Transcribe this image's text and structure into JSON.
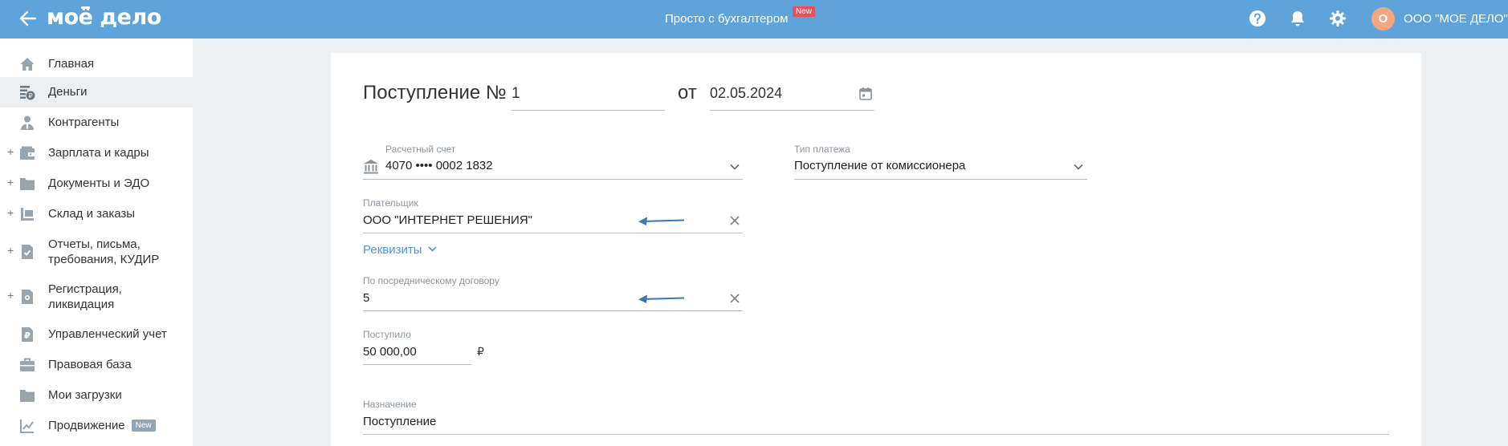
{
  "header": {
    "logo_text": "моё дело",
    "center_link": "Просто с бухгалтером",
    "center_badge": "New",
    "avatar_letter": "О",
    "org_name": "ООО \"МОЕ ДЕЛО\""
  },
  "sidebar": {
    "items": [
      {
        "label": "Главная",
        "icon": "home-icon",
        "expandable": false,
        "active": false
      },
      {
        "label": "Деньги",
        "icon": "money-icon",
        "expandable": false,
        "active": true
      },
      {
        "label": "Контрагенты",
        "icon": "contractor-icon",
        "expandable": false,
        "active": false
      },
      {
        "label": "Зарплата и кадры",
        "icon": "wallet-icon",
        "expandable": true,
        "active": false
      },
      {
        "label": "Документы и ЭДО",
        "icon": "folder-icon",
        "expandable": true,
        "active": false
      },
      {
        "label": "Склад и заказы",
        "icon": "warehouse-icon",
        "expandable": true,
        "active": false
      },
      {
        "label": "Отчеты, письма, требования, КУДИР",
        "icon": "report-icon",
        "expandable": true,
        "active": false
      },
      {
        "label": "Регистрация, ликвидация",
        "icon": "registration-icon",
        "expandable": true,
        "active": false
      },
      {
        "label": "Управленческий учет",
        "icon": "ruble-doc-icon",
        "expandable": false,
        "active": false
      },
      {
        "label": "Правовая база",
        "icon": "briefcase-icon",
        "expandable": false,
        "active": false
      },
      {
        "label": "Мои загрузки",
        "icon": "folder-icon",
        "expandable": false,
        "active": false
      },
      {
        "label": "Продвижение",
        "icon": "growth-chart-icon",
        "expandable": false,
        "active": false,
        "badge": "New"
      }
    ]
  },
  "form": {
    "title": "Поступление №",
    "number": "1",
    "date_prefix": "от",
    "date": "02.05.2024",
    "account_label": "Расчетный счет",
    "account_value": "4070 •••• 0002 1832",
    "payment_type_label": "Тип платежа",
    "payment_type_value": "Поступление от комиссионера",
    "payer_label": "Плательщик",
    "payer_value": "ООО \"ИНТЕРНЕТ РЕШЕНИЯ\"",
    "details_link": "Реквизиты",
    "contract_label": "По посредническому договору",
    "contract_value": "5",
    "amount_label": "Поступило",
    "amount_value": "50 000,00",
    "currency": "₽",
    "purpose_label": "Назначение",
    "purpose_value": "Поступление"
  },
  "colors": {
    "topbar": "#5ea3d9",
    "link": "#4a98d7",
    "annotation_arrow": "#3a76b8",
    "badge_red": "#e8505b"
  }
}
